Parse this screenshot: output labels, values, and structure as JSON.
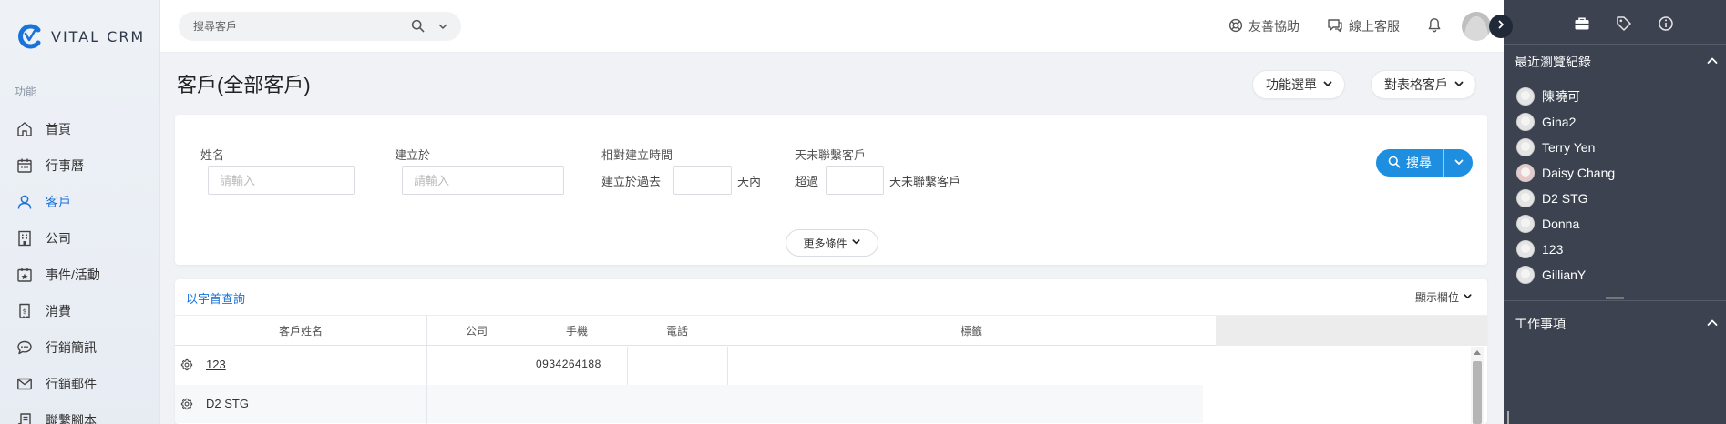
{
  "app": {
    "brand": "VITAL CRM"
  },
  "sidebar": {
    "section_label": "功能",
    "items": [
      {
        "label": "首頁",
        "icon": "home-icon",
        "active": false
      },
      {
        "label": "行事曆",
        "icon": "calendar-icon",
        "active": false
      },
      {
        "label": "客戶",
        "icon": "user-icon",
        "active": true
      },
      {
        "label": "公司",
        "icon": "building-icon",
        "active": false
      },
      {
        "label": "事件/活動",
        "icon": "event-calendar-icon",
        "active": false
      },
      {
        "label": "消費",
        "icon": "receipt-icon",
        "active": false
      },
      {
        "label": "行銷簡訊",
        "icon": "sms-icon",
        "active": false
      },
      {
        "label": "行銷郵件",
        "icon": "mail-icon",
        "active": false
      },
      {
        "label": "聯繫腳本",
        "icon": "script-icon",
        "active": false
      }
    ]
  },
  "topbar": {
    "search_placeholder": "搜尋客戶",
    "help_label": "友善協助",
    "support_label": "線上客服"
  },
  "page": {
    "title": "客戶(全部客戶)",
    "function_menu_label": "功能選單",
    "table_customers_label": "對表格客戶"
  },
  "filters": {
    "name_label": "姓名",
    "name_placeholder": "請輸入",
    "created_at_label": "建立於",
    "created_at_placeholder": "請輸入",
    "relative_time_label": "相對建立時間",
    "relative_prefix": "建立於過去",
    "relative_suffix": "天內",
    "no_contact_label": "天未聯繫客戶",
    "no_contact_prefix": "超過",
    "no_contact_suffix": "天未聯繫客戶",
    "search_button": "搜尋",
    "more_conditions": "更多條件"
  },
  "table": {
    "alpha_query": "以字首查詢",
    "show_columns": "顯示欄位",
    "headers": [
      "客戶姓名",
      "公司",
      "手機",
      "電話",
      "標籤"
    ],
    "rows": [
      {
        "name": "123",
        "company": "",
        "mobile": "0934264188",
        "phone": "",
        "tags": ""
      },
      {
        "name": "D2 STG",
        "company": "",
        "mobile": "",
        "phone": "",
        "tags": ""
      }
    ]
  },
  "right_panel": {
    "recent_title": "最近瀏覽紀錄",
    "recent": [
      "陳曉可",
      "Gina2",
      "Terry Yen",
      "Daisy Chang",
      "D2 STG",
      "Donna",
      "123",
      "GillianY"
    ],
    "tasks_title": "工作事項"
  },
  "colors": {
    "accent": "#1a73d9",
    "search_button": "#1e8fe0",
    "right_panel_bg": "#3c4250"
  }
}
